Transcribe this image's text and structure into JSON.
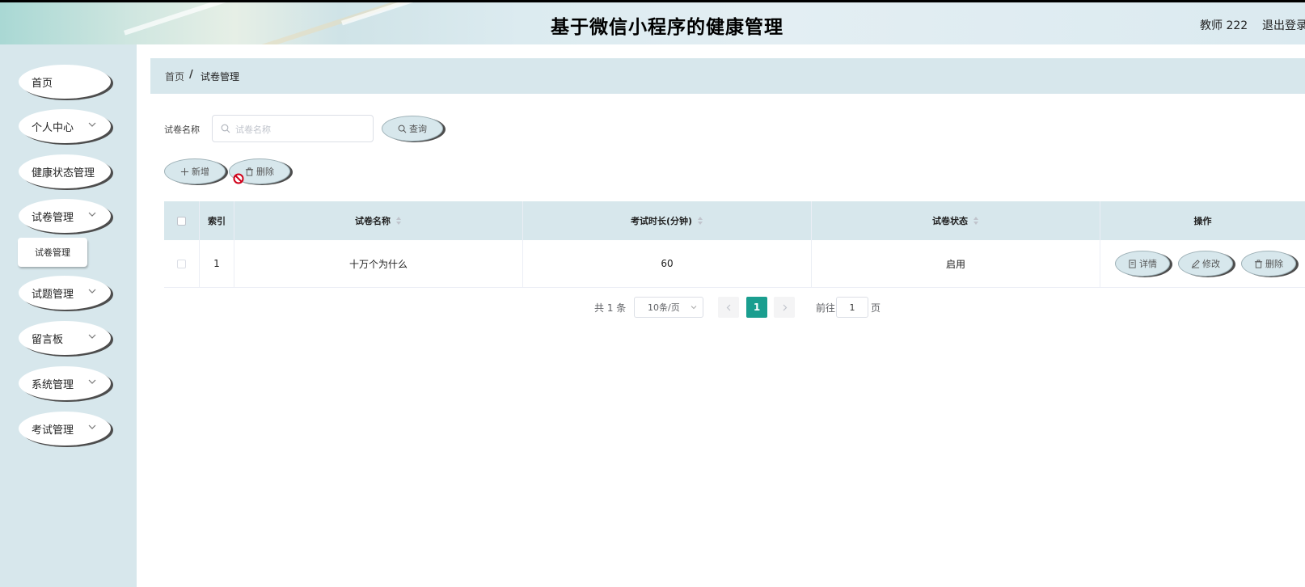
{
  "header": {
    "title": "基于微信小程序的健康管理",
    "user": "教师 222",
    "logout": "退出登录"
  },
  "sidebar": {
    "items": [
      {
        "label": "首页",
        "has_children": false
      },
      {
        "label": "个人中心",
        "has_children": true
      },
      {
        "label": "健康状态管理",
        "has_children": false
      },
      {
        "label": "试卷管理",
        "has_children": true
      },
      {
        "label": "试题管理",
        "has_children": true
      },
      {
        "label": "留言板",
        "has_children": true
      },
      {
        "label": "系统管理",
        "has_children": true
      },
      {
        "label": "考试管理",
        "has_children": true
      }
    ],
    "subitem": "试卷管理"
  },
  "breadcrumb": {
    "home": "首页",
    "separator": "/",
    "current": "试卷管理"
  },
  "search": {
    "label": "试卷名称",
    "placeholder": "试卷名称",
    "value": "",
    "button": "查询"
  },
  "toolbar": {
    "add": "新增",
    "delete": "删除"
  },
  "table": {
    "columns": [
      "索引",
      "试卷名称",
      "考试时长(分钟)",
      "试卷状态",
      "操作"
    ],
    "rows": [
      {
        "index": "1",
        "name": "十万个为什么",
        "duration": "60",
        "status": "启用"
      }
    ],
    "actions": {
      "detail": "详情",
      "edit": "修改",
      "delete": "删除"
    }
  },
  "pagination": {
    "total": "共 1 条",
    "page_size": "10条/页",
    "current_page": "1",
    "goto_label": "前往",
    "goto_value": "1",
    "page_unit": "页"
  },
  "colors": {
    "accent": "#1a9e8f",
    "panel": "#d7e7ec",
    "shadow": "#4d4d4d"
  }
}
